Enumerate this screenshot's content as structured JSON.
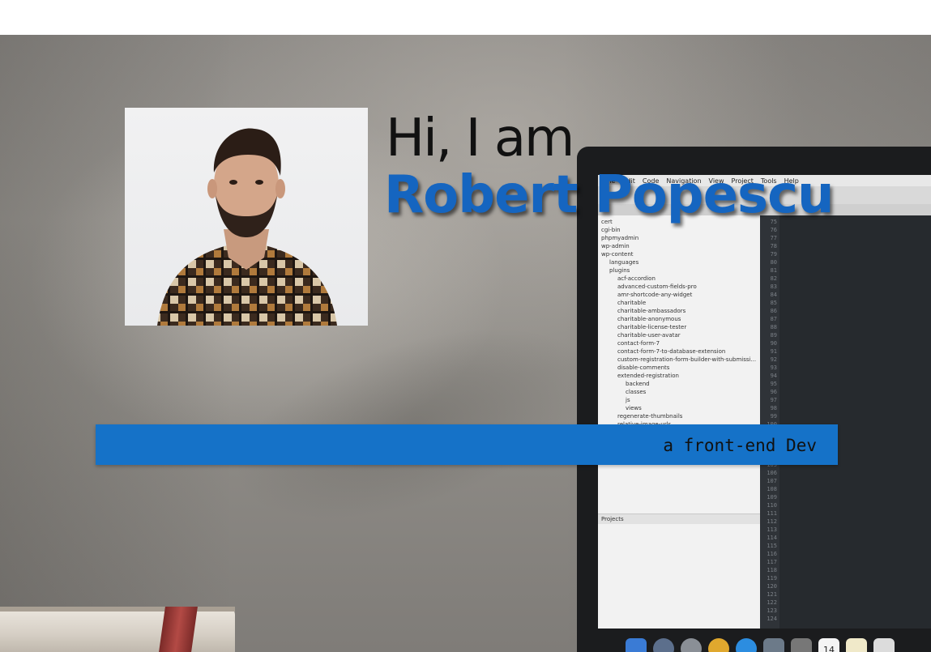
{
  "hero": {
    "greeting": "Hi, I am",
    "name": "Robert Popescu",
    "role": "a front-end Dev"
  },
  "colors": {
    "accent": "#1565c0",
    "role_bar": "#1572c8",
    "greeting_text": "#111111"
  },
  "background_screen": {
    "menu": [
      "File",
      "Edit",
      "Code",
      "Navigation",
      "View",
      "Project",
      "Tools",
      "Help"
    ],
    "tree_items": [
      "cert",
      "cgi-bin",
      "phpmyadmin",
      "wp-admin",
      "wp-content",
      "languages",
      "plugins",
      "acf-accordion",
      "advanced-custom-fields-pro",
      "amr-shortcode-any-widget",
      "charitable",
      "charitable-ambassadors",
      "charitable-anonymous",
      "charitable-license-tester",
      "charitable-user-avatar",
      "contact-form-7",
      "contact-form-7-to-database-extension",
      "custom-registration-form-builder-with-submissi...",
      "disable-comments",
      "extended-registration",
      "backend",
      "classes",
      "js",
      "views",
      "regenerate-thumbnails",
      "relative-image-urls"
    ],
    "projects_label": "Projects",
    "dock_date": "14"
  }
}
